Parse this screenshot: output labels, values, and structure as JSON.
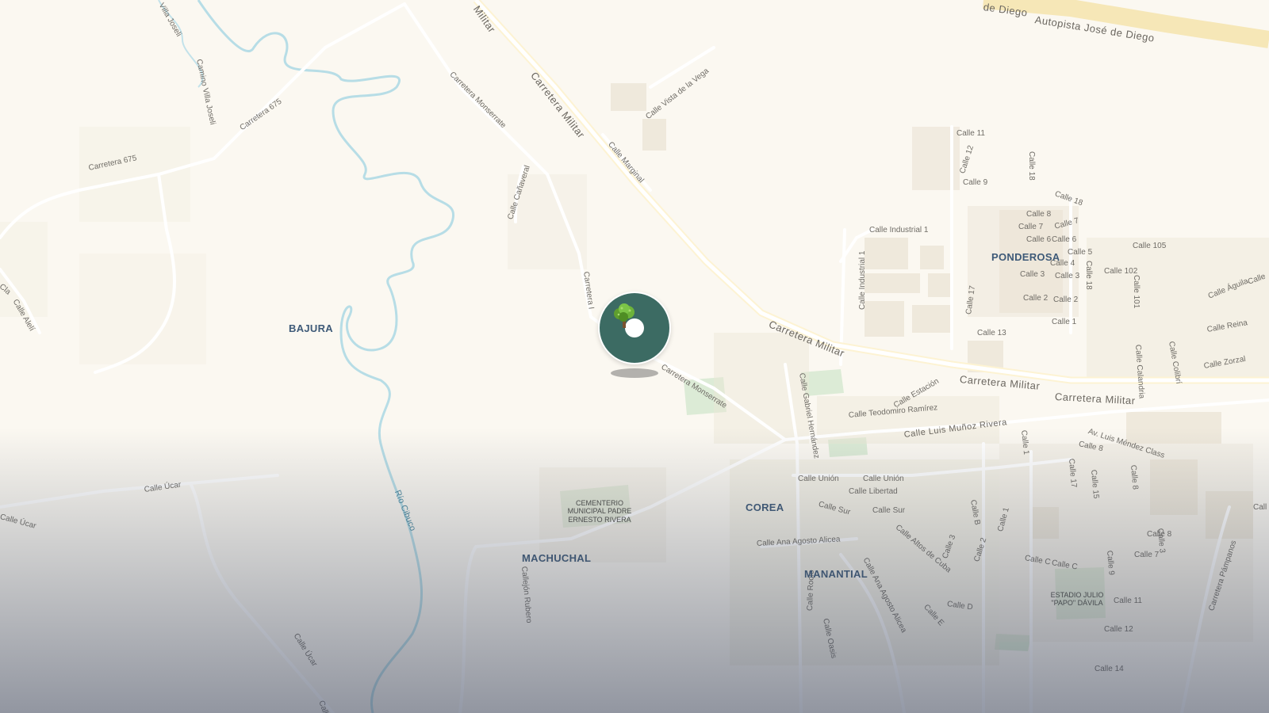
{
  "map": {
    "colors": {
      "land": "#fbf8f1",
      "road": "#ffffff",
      "highway": "#f6e7b7",
      "water": "#b7dde6",
      "park": "#dcebd6",
      "building": "#ece6d8",
      "marker": "#3c6b63",
      "hood_label": "#3e5a78"
    },
    "roads": {
      "autopista": "Autopista José de Diego",
      "autopista_partial": "de Diego",
      "militar_top": "Militar",
      "militar_1": "Carretera Militar",
      "militar_2": "Carretera Militar",
      "militar_3": "Carretera Militar",
      "militar_4": "Carretera Militar",
      "monserrate_1": "Carretera Monserrate",
      "monserrate_2": "Carretera Monserrate",
      "c675_1": "Carretera 675",
      "c675_2": "Carretera 675",
      "carretera_i": "Carretera I",
      "canaveral": "Calle Cañaveral",
      "marginal": "Calle Marginal",
      "vista_vega": "Calle Vista de la Vega",
      "camino_villa": "Camino Villa Joseli",
      "villa_joseli": "Villa Joseli",
      "industrial_1": "Calle Industrial 1",
      "industrial_1v": "Calle Industrial 1",
      "estacion": "Calle Estación",
      "teodomiro": "Calle Teodomiro Ramírez",
      "munoz": "Calle Luis Muñoz Rivera",
      "mendez": "Av. Luis Méndez Class",
      "gabriel": "Calle Gabriel Hernández",
      "union_1": "Calle Unión",
      "union_2": "Calle Unión",
      "libertad": "Calle Libertad",
      "sur_1": "Calle Sur",
      "sur_2": "Calle Sur",
      "altos": "Calle Altos de Cuba",
      "ana_1": "Calle Ana Agosto Alicea",
      "ana_2": "Calle Ana Agosto Alicea",
      "ucar_1": "Calle Úcar",
      "ucar_2": "Calle Úcar",
      "ucar_3": "Calle Úcar",
      "ucar_4": "Calle",
      "rubero": "Callejón Rubero",
      "rocio": "Calle Rocío",
      "oasis": "Calle Oasis",
      "aleli": "Calle Alelí",
      "cla": "Cla",
      "calle_1": "Calle 1",
      "calle_d": "Calle D",
      "calle_e": "Calle E",
      "calle_3": "Calle 3",
      "calle_2": "Calle 2",
      "calle_c1": "Calle C",
      "calle_c2": "Calle C",
      "calle_b": "Calle B",
      "calle_11": "Calle 11",
      "calle_12": "Calle 12",
      "calle_9": "Calle 9",
      "calle_18a": "Calle 18",
      "calle_18b": "Calle 18",
      "calle_18c": "Calle 18",
      "calle_8": "Calle 8",
      "calle_7": "Calle 7",
      "calle_7b": "Calle 7",
      "calle_6": "Calle 6",
      "calle_6b": "Calle 6",
      "calle_5": "Calle 5",
      "calle_4": "Calle 4",
      "calle_3b": "Calle 3",
      "calle_3c": "Calle 3",
      "calle_2b": "Calle 2",
      "calle_2c": "Calle 2",
      "calle_1b": "Calle 1",
      "calle_17": "Calle 17",
      "calle_13": "Calle 13",
      "calle_105": "Calle 105",
      "calle_102": "Calle 102",
      "calle_101": "Calle 101",
      "aguila": "Calle Águila",
      "reina": "Calle Reina",
      "zorzal": "Calle Zorzal",
      "colibri": "Calle Colibrí",
      "calandria": "Calle Calandria",
      "calle_8b": "Calle 8",
      "calle_17b": "Calle 17",
      "calle_15": "Calle 15",
      "calle_8c": "Calle 8",
      "calle_8d": "Calle 8",
      "calle_3d": "Calle 3",
      "calle_7c": "Calle 7",
      "calle_9b": "Calle 9",
      "calle_11b": "Calle 11",
      "calle_12b": "Calle 12",
      "calle_14": "Calle 14",
      "pampanos": "Carretera Pámpanos",
      "calle_1c": "Calle 1",
      "calle_edge": "Call",
      "calle_edge2": "Calle"
    },
    "water": {
      "river": "Río Cibuco"
    },
    "neighborhoods": {
      "bajura": "BAJURA",
      "ponderosa": "PONDEROSA",
      "corea": "COREA",
      "machuchal": "MACHUCHAL",
      "manantial": "MANANTIAL"
    },
    "pois": {
      "cemetery": "CEMENTERIO MUNICIPAL PADRE ERNESTO RIVERA",
      "stadium": "ESTADIO JULIO \"PAPO\" DÁVILA"
    },
    "marker": {
      "icon": "tree-icon"
    }
  }
}
